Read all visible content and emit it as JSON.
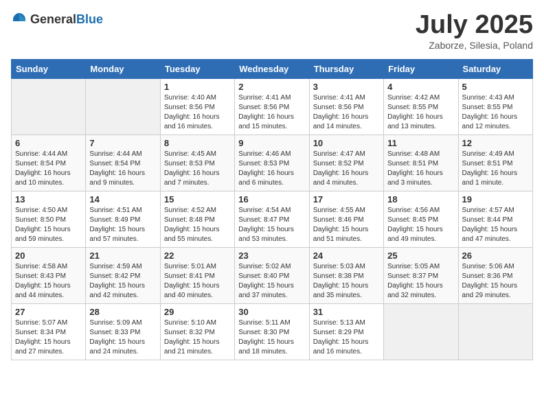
{
  "header": {
    "logo_general": "General",
    "logo_blue": "Blue",
    "month_title": "July 2025",
    "location": "Zaborze, Silesia, Poland"
  },
  "weekdays": [
    "Sunday",
    "Monday",
    "Tuesday",
    "Wednesday",
    "Thursday",
    "Friday",
    "Saturday"
  ],
  "weeks": [
    [
      {
        "day": "",
        "sunrise": "",
        "sunset": "",
        "daylight": ""
      },
      {
        "day": "",
        "sunrise": "",
        "sunset": "",
        "daylight": ""
      },
      {
        "day": "1",
        "sunrise": "Sunrise: 4:40 AM",
        "sunset": "Sunset: 8:56 PM",
        "daylight": "Daylight: 16 hours and 16 minutes."
      },
      {
        "day": "2",
        "sunrise": "Sunrise: 4:41 AM",
        "sunset": "Sunset: 8:56 PM",
        "daylight": "Daylight: 16 hours and 15 minutes."
      },
      {
        "day": "3",
        "sunrise": "Sunrise: 4:41 AM",
        "sunset": "Sunset: 8:56 PM",
        "daylight": "Daylight: 16 hours and 14 minutes."
      },
      {
        "day": "4",
        "sunrise": "Sunrise: 4:42 AM",
        "sunset": "Sunset: 8:55 PM",
        "daylight": "Daylight: 16 hours and 13 minutes."
      },
      {
        "day": "5",
        "sunrise": "Sunrise: 4:43 AM",
        "sunset": "Sunset: 8:55 PM",
        "daylight": "Daylight: 16 hours and 12 minutes."
      }
    ],
    [
      {
        "day": "6",
        "sunrise": "Sunrise: 4:44 AM",
        "sunset": "Sunset: 8:54 PM",
        "daylight": "Daylight: 16 hours and 10 minutes."
      },
      {
        "day": "7",
        "sunrise": "Sunrise: 4:44 AM",
        "sunset": "Sunset: 8:54 PM",
        "daylight": "Daylight: 16 hours and 9 minutes."
      },
      {
        "day": "8",
        "sunrise": "Sunrise: 4:45 AM",
        "sunset": "Sunset: 8:53 PM",
        "daylight": "Daylight: 16 hours and 7 minutes."
      },
      {
        "day": "9",
        "sunrise": "Sunrise: 4:46 AM",
        "sunset": "Sunset: 8:53 PM",
        "daylight": "Daylight: 16 hours and 6 minutes."
      },
      {
        "day": "10",
        "sunrise": "Sunrise: 4:47 AM",
        "sunset": "Sunset: 8:52 PM",
        "daylight": "Daylight: 16 hours and 4 minutes."
      },
      {
        "day": "11",
        "sunrise": "Sunrise: 4:48 AM",
        "sunset": "Sunset: 8:51 PM",
        "daylight": "Daylight: 16 hours and 3 minutes."
      },
      {
        "day": "12",
        "sunrise": "Sunrise: 4:49 AM",
        "sunset": "Sunset: 8:51 PM",
        "daylight": "Daylight: 16 hours and 1 minute."
      }
    ],
    [
      {
        "day": "13",
        "sunrise": "Sunrise: 4:50 AM",
        "sunset": "Sunset: 8:50 PM",
        "daylight": "Daylight: 15 hours and 59 minutes."
      },
      {
        "day": "14",
        "sunrise": "Sunrise: 4:51 AM",
        "sunset": "Sunset: 8:49 PM",
        "daylight": "Daylight: 15 hours and 57 minutes."
      },
      {
        "day": "15",
        "sunrise": "Sunrise: 4:52 AM",
        "sunset": "Sunset: 8:48 PM",
        "daylight": "Daylight: 15 hours and 55 minutes."
      },
      {
        "day": "16",
        "sunrise": "Sunrise: 4:54 AM",
        "sunset": "Sunset: 8:47 PM",
        "daylight": "Daylight: 15 hours and 53 minutes."
      },
      {
        "day": "17",
        "sunrise": "Sunrise: 4:55 AM",
        "sunset": "Sunset: 8:46 PM",
        "daylight": "Daylight: 15 hours and 51 minutes."
      },
      {
        "day": "18",
        "sunrise": "Sunrise: 4:56 AM",
        "sunset": "Sunset: 8:45 PM",
        "daylight": "Daylight: 15 hours and 49 minutes."
      },
      {
        "day": "19",
        "sunrise": "Sunrise: 4:57 AM",
        "sunset": "Sunset: 8:44 PM",
        "daylight": "Daylight: 15 hours and 47 minutes."
      }
    ],
    [
      {
        "day": "20",
        "sunrise": "Sunrise: 4:58 AM",
        "sunset": "Sunset: 8:43 PM",
        "daylight": "Daylight: 15 hours and 44 minutes."
      },
      {
        "day": "21",
        "sunrise": "Sunrise: 4:59 AM",
        "sunset": "Sunset: 8:42 PM",
        "daylight": "Daylight: 15 hours and 42 minutes."
      },
      {
        "day": "22",
        "sunrise": "Sunrise: 5:01 AM",
        "sunset": "Sunset: 8:41 PM",
        "daylight": "Daylight: 15 hours and 40 minutes."
      },
      {
        "day": "23",
        "sunrise": "Sunrise: 5:02 AM",
        "sunset": "Sunset: 8:40 PM",
        "daylight": "Daylight: 15 hours and 37 minutes."
      },
      {
        "day": "24",
        "sunrise": "Sunrise: 5:03 AM",
        "sunset": "Sunset: 8:38 PM",
        "daylight": "Daylight: 15 hours and 35 minutes."
      },
      {
        "day": "25",
        "sunrise": "Sunrise: 5:05 AM",
        "sunset": "Sunset: 8:37 PM",
        "daylight": "Daylight: 15 hours and 32 minutes."
      },
      {
        "day": "26",
        "sunrise": "Sunrise: 5:06 AM",
        "sunset": "Sunset: 8:36 PM",
        "daylight": "Daylight: 15 hours and 29 minutes."
      }
    ],
    [
      {
        "day": "27",
        "sunrise": "Sunrise: 5:07 AM",
        "sunset": "Sunset: 8:34 PM",
        "daylight": "Daylight: 15 hours and 27 minutes."
      },
      {
        "day": "28",
        "sunrise": "Sunrise: 5:09 AM",
        "sunset": "Sunset: 8:33 PM",
        "daylight": "Daylight: 15 hours and 24 minutes."
      },
      {
        "day": "29",
        "sunrise": "Sunrise: 5:10 AM",
        "sunset": "Sunset: 8:32 PM",
        "daylight": "Daylight: 15 hours and 21 minutes."
      },
      {
        "day": "30",
        "sunrise": "Sunrise: 5:11 AM",
        "sunset": "Sunset: 8:30 PM",
        "daylight": "Daylight: 15 hours and 18 minutes."
      },
      {
        "day": "31",
        "sunrise": "Sunrise: 5:13 AM",
        "sunset": "Sunset: 8:29 PM",
        "daylight": "Daylight: 15 hours and 16 minutes."
      },
      {
        "day": "",
        "sunrise": "",
        "sunset": "",
        "daylight": ""
      },
      {
        "day": "",
        "sunrise": "",
        "sunset": "",
        "daylight": ""
      }
    ]
  ]
}
